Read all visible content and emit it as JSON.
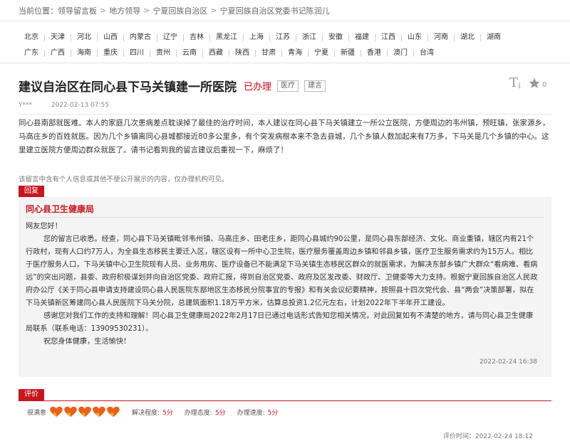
{
  "breadcrumb": {
    "prefix": "当前位置：",
    "items": [
      "领导留言板",
      "地方领导",
      "宁夏回族自治区",
      "宁夏回族自治区党委书记陈润儿"
    ],
    "separator": ">"
  },
  "regions": {
    "row1": [
      "北京",
      "天津",
      "河北",
      "山西",
      "内蒙古",
      "辽宁",
      "吉林",
      "黑龙江",
      "上海",
      "江苏",
      "浙江",
      "安徽",
      "福建",
      "江西",
      "山东",
      "河南",
      "湖北",
      "湖南"
    ],
    "row2": [
      "广东",
      "广西",
      "海南",
      "重庆",
      "四川",
      "贵州",
      "云南",
      "西藏",
      "陕西",
      "甘肃",
      "青海",
      "宁夏",
      "新疆",
      "香港",
      "澳门",
      "台湾"
    ]
  },
  "post": {
    "title": "建议自治区在同心县下马关镇建一所医院",
    "status": "已办理",
    "tags": [
      "医疗",
      "建言"
    ],
    "font_icon": "T",
    "star_icon": "star-icon",
    "star_count": "0",
    "author": "Y***",
    "date": "2022-02-13 07:55",
    "content": "同心县南部就医难。本人的家庭几次患病差点耽误掉了最佳的治疗时间，本人建议在同心县下马关镇建立一所公立医院，方便周边的韦州镇，预旺镇，张家源乡，马高庄乡的百姓就医。因为几个乡镇离同心县城都接近80多公里多，有个突发病根本来不急去县城，几个乡镇人数加起来有7万多，下马关是几个乡镇的中心。这里建立医院方便周边群众就医了。请书记看到我的留言建议后重视一下，麻烦了！",
    "privacy_note": "该留言中含有个人信息或其他不便公开展示的内容，仅办理机构可见。"
  },
  "reply": {
    "label": "回复",
    "org": "同心县卫生健康局",
    "greeting": "网友您好！",
    "para1": "您的留言已收悉。经查，同心县下马关镇毗邻韦州镇、马高庄乡、田老庄乡，距同心县城约90公里，是同心县东部经济、文化、商业重镇，辖区内有21个行政村，现有人口约7万人，为全县生态移民主要迁入区，辖区设有一所中心卫生院，医疗服务覆盖周边乡镇和邻县乡镇，医疗卫生服务需求约为15万人。相比于医疗服务人口，下马关镇中心卫生院现有人员、业务用房、医疗设备已不能满足下马关镇生态移民区群众的就医需求，为解决东部乡镇广大群众“看病难、看病远”的突出问题，县委、政府积极谋划并向自治区党委、政府汇报，得到自治区党委、政府及区发改委、财政厅、卫健委等大力支持。根据宁夏回族自治区人民政府办公厅《关于同心县申请支持建设同心县人民医院东部地区生态移民分院事宜的专报》和有关会议纪要精神，按照县十四次党代会、县“两会”决策部署，拟在下马关镇新区筹建同心县人民医院下马关分院，总建筑面积1.18万平方米，估算总投资1.2亿元左右，计划2022年下半年开工建设。",
    "para2": "感谢您对我们工作的支持和理解！同心县卫生健康局2022年2月17日已通过电话形式告知您相关情况，对此回复如有不清楚的地方，请与同心县卫生健康局联系（联系电话：13909530231）。",
    "closing": "祝您身体健康，生活愉快！",
    "date": "2022-02-24 16:38"
  },
  "rating": {
    "label": "评价",
    "satisfaction_label": "很满意",
    "hearts": 5,
    "heart_color": "#e8621c",
    "scores": [
      {
        "label": "解决程度:",
        "value": "5分"
      },
      {
        "label": "办理态度:",
        "value": "5分"
      },
      {
        "label": "办理速度:",
        "value": "5分"
      }
    ],
    "time_label": "评价时间：",
    "time": "2022-02-24 18:12"
  },
  "colors": {
    "accent": "#c8161d",
    "status": "#d0021b"
  }
}
